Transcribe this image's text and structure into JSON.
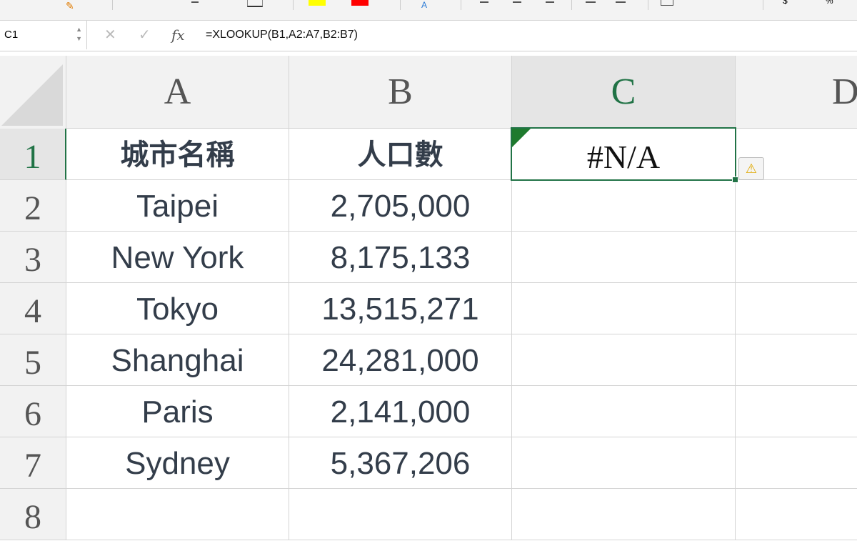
{
  "name_box": "C1",
  "formula": "=XLOOKUP(B1,A2:A7,B2:B7)",
  "fx_label": "fx",
  "columns": [
    "A",
    "B",
    "C",
    "D"
  ],
  "rows": [
    "1",
    "2",
    "3",
    "4",
    "5",
    "6",
    "7",
    "8"
  ],
  "cells": [
    [
      "城市名稱",
      "人口數"
    ],
    [
      "Taipei",
      "2,705,000"
    ],
    [
      "New York",
      "8,175,133"
    ],
    [
      "Tokyo",
      "13,515,271"
    ],
    [
      "Shanghai",
      "24,281,000"
    ],
    [
      "Paris",
      "2,141,000"
    ],
    [
      "Sydney",
      "5,367,206"
    ]
  ],
  "c1_value": "#N/A",
  "colors": {
    "accent": "#217346",
    "fill_yellow": "#ffff00",
    "font_red": "#ff0000"
  }
}
